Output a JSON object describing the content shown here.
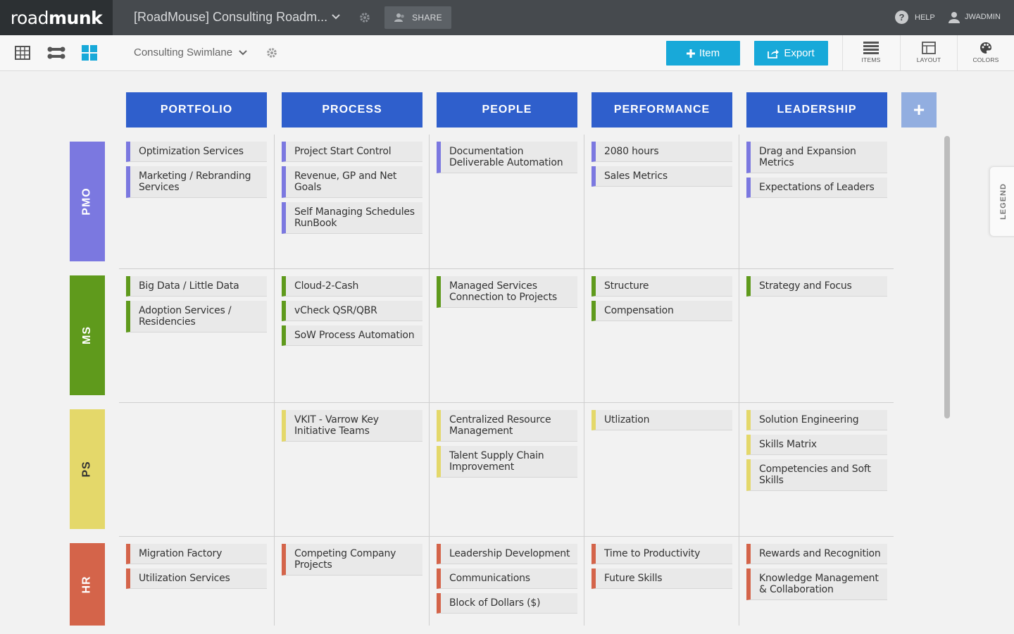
{
  "app": {
    "logo_light": "road",
    "logo_bold": "munk"
  },
  "topbar": {
    "project_title": "[RoadMouse] Consulting Roadm...",
    "share_label": "SHARE",
    "help_label": "HELP",
    "user_label": "JWADMIN"
  },
  "toolbar": {
    "swimlane_name": "Consulting Swimlane",
    "add_item_label": "Item",
    "export_label": "Export",
    "tabs": [
      {
        "label": "ITEMS",
        "icon": "list-icon"
      },
      {
        "label": "LAYOUT",
        "icon": "layout-icon"
      },
      {
        "label": "COLORS",
        "icon": "palette-icon"
      }
    ]
  },
  "columns": [
    "PORTFOLIO",
    "PROCESS",
    "PEOPLE",
    "PERFORMANCE",
    "LEADERSHIP"
  ],
  "lanes": [
    {
      "label": "PMO",
      "color": "#7b78e0"
    },
    {
      "label": "MS",
      "color": "#5f9a1c"
    },
    {
      "label": "PS",
      "color": "#e4d86a"
    },
    {
      "label": "HR",
      "color": "#d4644a"
    }
  ],
  "cards": {
    "PMO": [
      [
        "Optimization Services",
        "Marketing / Rebranding Services"
      ],
      [
        "Project Start Control",
        "Revenue, GP and Net Goals",
        "Self Managing Schedules RunBook"
      ],
      [
        "Documentation Deliverable Automation"
      ],
      [
        "2080 hours",
        "Sales Metrics"
      ],
      [
        "Drag and Expansion Metrics",
        "Expectations of Leaders"
      ]
    ],
    "MS": [
      [
        "Big Data / Little Data",
        "Adoption Services / Residencies"
      ],
      [
        "Cloud-2-Cash",
        "vCheck QSR/QBR",
        "SoW Process Automation"
      ],
      [
        "Managed Services Connection to Projects"
      ],
      [
        "Structure",
        "Compensation"
      ],
      [
        "Strategy and Focus"
      ]
    ],
    "PS": [
      [],
      [
        "VKIT - Varrow Key Initiative Teams"
      ],
      [
        "Centralized Resource Management",
        "Talent Supply Chain Improvement"
      ],
      [
        "Utlization"
      ],
      [
        "Solution Engineering",
        "Skills Matrix",
        "Competencies and Soft Skills"
      ]
    ],
    "HR": [
      [
        "Migration Factory",
        "Utilization Services"
      ],
      [
        "Competing Company Projects"
      ],
      [
        "Leadership Development",
        "Communications",
        "Block of Dollars ($)"
      ],
      [
        "Time to Productivity",
        "Future Skills"
      ],
      [
        "Rewards and Recognition",
        "Knowledge Management & Collaboration"
      ]
    ]
  },
  "legend_label": "LEGEND",
  "colors": {
    "header_blue": "#2f5fcc",
    "accent_cyan": "#18a9d9"
  }
}
